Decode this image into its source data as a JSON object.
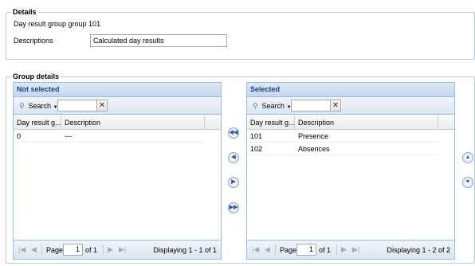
{
  "details": {
    "legend": "Details",
    "group_name": "Day result group group 101",
    "descriptions_label": "Descriptions",
    "descriptions_value": "Calculated day results"
  },
  "group_details": {
    "legend": "Group details"
  },
  "not_selected": {
    "title": "Not selected",
    "search_label": "Search",
    "search_value": "",
    "columns": [
      "Day result g...",
      "Description"
    ],
    "rows": [
      {
        "code": "0",
        "description": "---"
      }
    ],
    "pager": {
      "page_label": "Page",
      "page": "1",
      "of": "of 1",
      "display": "Displaying 1 - 1 of 1"
    }
  },
  "selected": {
    "title": "Selected",
    "search_label": "Search",
    "search_value": "",
    "columns": [
      "Day result g...",
      "Description"
    ],
    "rows": [
      {
        "code": "101",
        "description": "Presence"
      },
      {
        "code": "102",
        "description": "Absences"
      }
    ],
    "pager": {
      "page_label": "Page",
      "page": "1",
      "of": "of 1",
      "display": "Displaying 1 - 2 of 2"
    }
  },
  "icons": {
    "move_all_left": "double-left-arrow-icon",
    "move_left": "left-arrow-icon",
    "move_right": "right-arrow-icon",
    "move_all_right": "double-right-arrow-icon",
    "move_up": "up-arrow-icon",
    "move_down": "down-arrow-icon"
  },
  "colors": {
    "panel_header_text": "#15428b",
    "panel_border": "#99bbe8",
    "fieldset_border": "#b5c9e3"
  }
}
